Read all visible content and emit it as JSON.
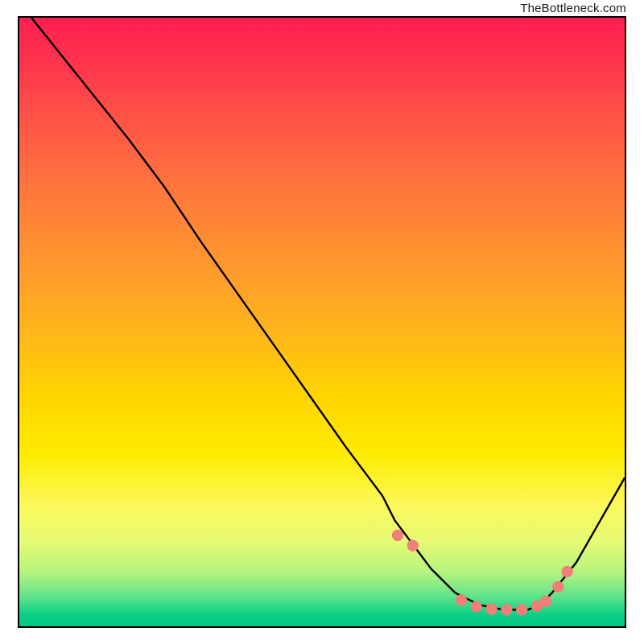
{
  "attribution": "TheBottleneck.com",
  "chart_data": {
    "type": "line",
    "title": "",
    "xlabel": "",
    "ylabel": "",
    "xlim": [
      0,
      100
    ],
    "ylim": [
      0,
      100
    ],
    "grid": false,
    "series": [
      {
        "name": "gradient-heatmap",
        "description": "vertical red-to-green gradient background"
      },
      {
        "name": "bottleneck-curve",
        "x": [
          2,
          6,
          10,
          14,
          18,
          24,
          30,
          36,
          42,
          48,
          54,
          60,
          62,
          65,
          68,
          72,
          76,
          80,
          84,
          86,
          88,
          92,
          96,
          100
        ],
        "y": [
          100,
          95,
          90,
          85,
          80,
          72,
          63,
          54.5,
          46,
          37.5,
          29,
          21,
          17,
          13,
          9,
          5,
          3,
          2.2,
          2.2,
          3,
          5,
          10,
          17,
          24
        ]
      },
      {
        "name": "marker-dots",
        "x": [
          62.5,
          65,
          73,
          75.5,
          78,
          80.5,
          83,
          85.5,
          87,
          89,
          90.5
        ],
        "y": [
          14.5,
          12.8,
          3.8,
          2.7,
          2.3,
          2.2,
          2.2,
          2.8,
          3.6,
          6.0,
          8.5
        ],
        "style": "coral-dots"
      }
    ],
    "colors": {
      "curve": "#000000",
      "dot": "#f08077"
    }
  }
}
